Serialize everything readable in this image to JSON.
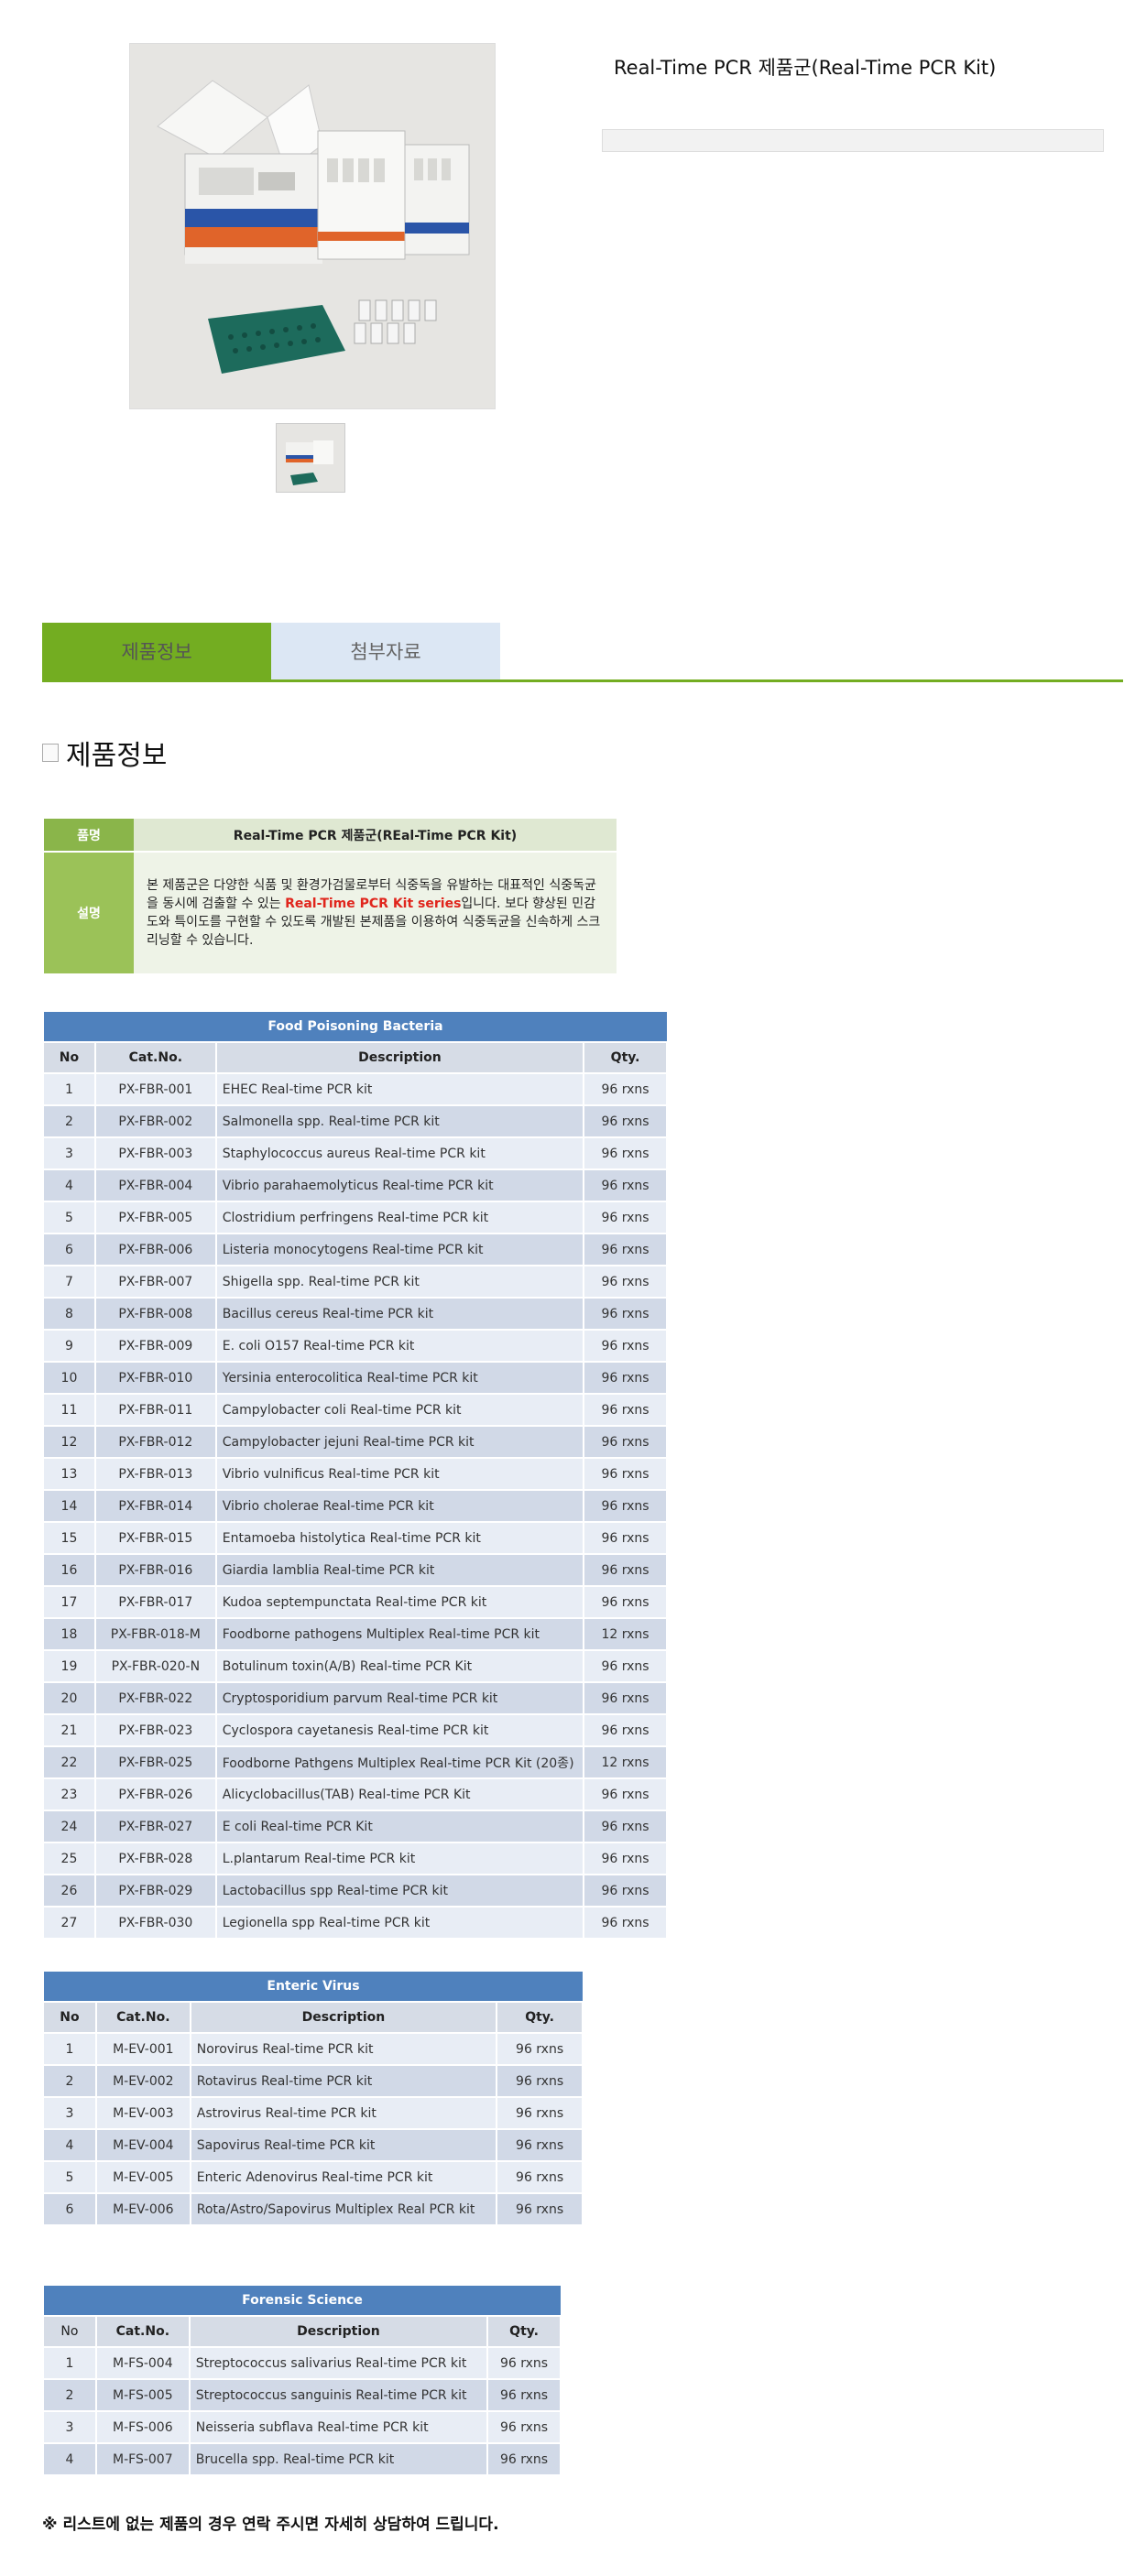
{
  "product": {
    "title": "Real-Time PCR 제품군(Real-Time PCR Kit)",
    "image_alt": "product-kit-photo"
  },
  "tabs": [
    {
      "label": "제품정보"
    },
    {
      "label": "첨부자료"
    }
  ],
  "section_title": "제품정보",
  "info": {
    "name_label": "품명",
    "name_value": "Real-Time PCR 제품군(REal-Time PCR Kit)",
    "desc_label": "설명",
    "desc_before": "본 제품군은 다양한 식품 및 환경가검물로부터 식중독을 유발하는 대표적인 식중독균을 동시에 검출할 수 있는 ",
    "desc_highlight": "Real-Time PCR Kit series",
    "desc_after": "입니다. 보다 향상된 민감도와 특이도를 구현할 수 있도록 개발된 본제품을 이용하여 식중독균을 신속하게 스크리닝할 수 있습니다."
  },
  "headers": {
    "no": "No",
    "cat": "Cat.No.",
    "desc": "Description",
    "qty": "Qty."
  },
  "tables": [
    {
      "caption": "Food Poisoning Bacteria",
      "rows": [
        [
          "1",
          "PX-FBR-001",
          "EHEC Real-time PCR kit",
          "96 rxns"
        ],
        [
          "2",
          "PX-FBR-002",
          "Salmonella spp. Real-time PCR kit",
          "96 rxns"
        ],
        [
          "3",
          "PX-FBR-003",
          "Staphylococcus aureus Real-time PCR kit",
          "96 rxns"
        ],
        [
          "4",
          "PX-FBR-004",
          "Vibrio parahaemolyticus Real-time PCR kit",
          "96 rxns"
        ],
        [
          "5",
          "PX-FBR-005",
          "Clostridium perfringens Real-time PCR kit",
          "96 rxns"
        ],
        [
          "6",
          "PX-FBR-006",
          "Listeria monocytogens Real-time PCR kit",
          "96 rxns"
        ],
        [
          "7",
          "PX-FBR-007",
          "Shigella spp. Real-time PCR kit",
          "96 rxns"
        ],
        [
          "8",
          "PX-FBR-008",
          "Bacillus cereus Real-time PCR kit",
          "96 rxns"
        ],
        [
          "9",
          "PX-FBR-009",
          "E. coli O157 Real-time PCR kit",
          "96 rxns"
        ],
        [
          "10",
          "PX-FBR-010",
          "Yersinia enterocolitica Real-time PCR kit",
          "96 rxns"
        ],
        [
          "11",
          "PX-FBR-011",
          "Campylobacter coli Real-time PCR kit",
          "96 rxns"
        ],
        [
          "12",
          "PX-FBR-012",
          "Campylobacter jejuni Real-time PCR kit",
          "96 rxns"
        ],
        [
          "13",
          "PX-FBR-013",
          "Vibrio vulnificus Real-time PCR kit",
          "96 rxns"
        ],
        [
          "14",
          "PX-FBR-014",
          "Vibrio cholerae Real-time PCR kit",
          "96 rxns"
        ],
        [
          "15",
          "PX-FBR-015",
          "Entamoeba histolytica Real-time PCR kit",
          "96 rxns"
        ],
        [
          "16",
          "PX-FBR-016",
          "Giardia lamblia Real-time PCR kit",
          "96 rxns"
        ],
        [
          "17",
          "PX-FBR-017",
          "Kudoa septempunctata Real-time PCR kit",
          "96 rxns"
        ],
        [
          "18",
          "PX-FBR-018-M",
          "Foodborne pathogens Multiplex Real-time PCR kit",
          "12 rxns"
        ],
        [
          "19",
          "PX-FBR-020-N",
          "Botulinum toxin(A/B) Real-time PCR Kit",
          "96 rxns"
        ],
        [
          "20",
          "PX-FBR-022",
          "Cryptosporidium parvum Real-time PCR kit",
          "96 rxns"
        ],
        [
          "21",
          "PX-FBR-023",
          "Cyclospora cayetanesis Real-time PCR kit",
          "96 rxns"
        ],
        [
          "22",
          "PX-FBR-025",
          "Foodborne Pathgens Multiplex Real-time PCR Kit (20종)",
          "12 rxns"
        ],
        [
          "23",
          "PX-FBR-026",
          "Alicyclobacillus(TAB) Real-time PCR Kit",
          "96 rxns"
        ],
        [
          "24",
          "PX-FBR-027",
          "E coli Real-time PCR Kit",
          "96 rxns"
        ],
        [
          "25",
          "PX-FBR-028",
          "L.plantarum Real-time PCR kit",
          "96 rxns"
        ],
        [
          "26",
          "PX-FBR-029",
          "Lactobacillus spp Real-time PCR kit",
          "96 rxns"
        ],
        [
          "27",
          "PX-FBR-030",
          "Legionella spp Real-time PCR kit",
          "96 rxns"
        ]
      ]
    },
    {
      "caption": "Enteric Virus",
      "rows": [
        [
          "1",
          "M-EV-001",
          "Norovirus Real-time PCR kit",
          "96 rxns"
        ],
        [
          "2",
          "M-EV-002",
          "Rotavirus Real-time PCR kit",
          "96 rxns"
        ],
        [
          "3",
          "M-EV-003",
          "Astrovirus Real-time PCR kit",
          "96 rxns"
        ],
        [
          "4",
          "M-EV-004",
          "Sapovirus Real-time PCR kit",
          "96 rxns"
        ],
        [
          "5",
          "M-EV-005",
          "Enteric Adenovirus Real-time PCR kit",
          "96 rxns"
        ],
        [
          "6",
          "M-EV-006",
          "Rota/Astro/Sapovirus Multiplex Real PCR kit",
          "96 rxns"
        ]
      ]
    },
    {
      "caption": "Forensic Science",
      "rows": [
        [
          "1",
          "M-FS-004",
          "Streptococcus salivarius Real-time PCR kit",
          "96 rxns"
        ],
        [
          "2",
          "M-FS-005",
          "Streptococcus sanguinis Real-time PCR kit",
          "96 rxns"
        ],
        [
          "3",
          "M-FS-006",
          "Neisseria subflava Real-time PCR kit",
          "96 rxns"
        ],
        [
          "4",
          "M-FS-007",
          "Brucella spp. Real-time PCR kit",
          "96 rxns"
        ]
      ]
    }
  ],
  "note": "※ 리스트에 없는 제품의 경우 연락 주시면 자세히 상담하여 드립니다."
}
